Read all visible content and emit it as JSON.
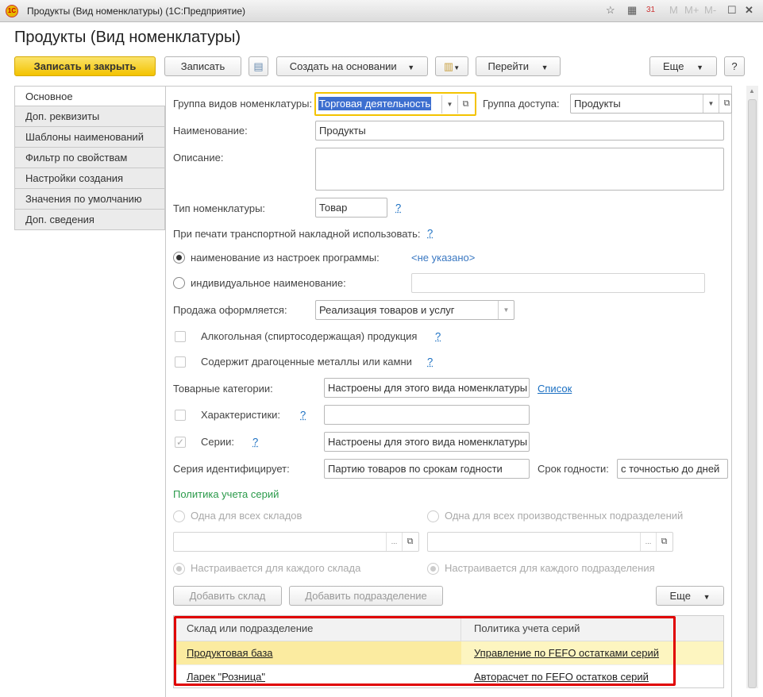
{
  "window": {
    "title": "Продукты (Вид номенклатуры)  (1С:Предприятие)",
    "icons": [
      "favorite-icon",
      "calculator-icon",
      "calendar-icon"
    ],
    "m": "M",
    "mplus": "M+",
    "mminus": "M-",
    "calendar_day": "31"
  },
  "form": {
    "title": "Продукты (Вид номенклатуры)"
  },
  "toolbar": {
    "save_close": "Записать и закрыть",
    "save": "Записать",
    "create_based": "Создать на основании",
    "go": "Перейти",
    "more": "Еще",
    "help": "?"
  },
  "tabs": [
    "Основное",
    "Доп. реквизиты",
    "Шаблоны наименований",
    "Фильтр по свойствам",
    "Настройки создания",
    "Значения по умолчанию",
    "Доп. сведения"
  ],
  "fields": {
    "group_label": "Группа видов номенклатуры:",
    "group_value": "Торговая деятельность",
    "access_label": "Группа доступа:",
    "access_value": "Продукты",
    "name_label": "Наименование:",
    "name_value": "Продукты",
    "desc_label": "Описание:",
    "desc_value": "",
    "type_label": "Тип номенклатуры:",
    "type_value": "Товар",
    "hint": "?",
    "print_label": "При печати транспортной накладной использовать:",
    "radio_settings": "наименование из настроек программы:",
    "not_set": "<не указано>",
    "radio_individual": "индивидуальное наименование:",
    "individual_value": "",
    "sale_label": "Продажа оформляется:",
    "sale_value": "Реализация товаров и услуг",
    "alcohol": "Алкогольная (спиртосодержащая) продукция",
    "precious": "Содержит драгоценные металлы или камни",
    "categories_label": "Товарные категории:",
    "categories_value": "Настроены для этого вида номенклатуры",
    "categories_link": "Список",
    "characteristics": "Характеристики:",
    "characteristics_value": "",
    "series": "Серии:",
    "series_value": "Настроены для этого вида номенклатуры",
    "series_id_label": "Серия идентифицирует:",
    "series_id_value": "Партию товаров по срокам годности",
    "expiry_label": "Срок годности:",
    "expiry_value": "с точностью до дней"
  },
  "policy": {
    "title": "Политика учета серий",
    "one_all_wh": "Одна для всех складов",
    "one_all_div": "Одна для всех производственных подразделений",
    "each_wh": "Настраивается для каждого склада",
    "each_div": "Настраивается для каждого подразделения",
    "add_wh": "Добавить склад",
    "add_div": "Добавить подразделение",
    "more": "Еще"
  },
  "table": {
    "columns": [
      "Склад или подразделение",
      "Политика учета серий"
    ],
    "rows": [
      {
        "place": "Продуктовая база",
        "policy": "Управление по FEFO остатками серий"
      },
      {
        "place": "Ларек \"Розница\"",
        "policy": "Авторасчет по FEFO остатков серий"
      }
    ]
  },
  "colors": {
    "accent": "#f3c300",
    "highlight_row": "#fdf2b0",
    "annotation": "#e00000",
    "link": "#1a6fc2",
    "group_title": "#2a9a4a"
  }
}
